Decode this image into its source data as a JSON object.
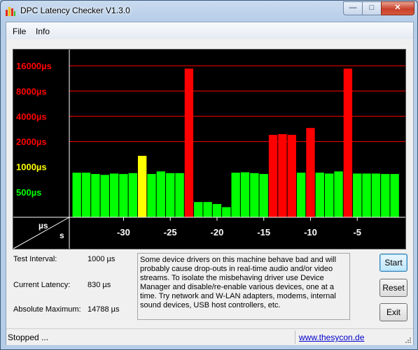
{
  "window": {
    "title": "DPC Latency Checker V1.3.0",
    "buttons": {
      "minimize": "—",
      "maximize": "□",
      "close": "✕"
    }
  },
  "menu": {
    "file": "File",
    "info": "Info"
  },
  "chart_data": {
    "type": "bar",
    "title": "",
    "xlabel": "s",
    "ylabel": "µs",
    "y_scale": "log2",
    "ylim": [
      250,
      24000
    ],
    "xlim": [
      -35.8,
      0
    ],
    "x_ticks": [
      -30,
      -25,
      -20,
      -15,
      -10,
      -5
    ],
    "x_tick_labels": [
      "-30",
      "-25",
      "-20",
      "-15",
      "-10",
      "-5"
    ],
    "y_ticks": [
      {
        "value": 16000,
        "label": "16000µs",
        "color": "#ff0000"
      },
      {
        "value": 8000,
        "label": "8000µs",
        "color": "#ff0000"
      },
      {
        "value": 4000,
        "label": "4000µs",
        "color": "#ff0000"
      },
      {
        "value": 2000,
        "label": "2000µs",
        "color": "#ff0000"
      },
      {
        "value": 1000,
        "label": "1000µs",
        "color": "#ffff00"
      },
      {
        "value": 500,
        "label": "500µs",
        "color": "#00ff00"
      }
    ],
    "bar_x": [
      -35,
      -34,
      -33,
      -32,
      -31,
      -30,
      -29,
      -28,
      -27,
      -26,
      -25,
      -24,
      -23,
      -22,
      -21,
      -20,
      -19,
      -18,
      -17,
      -16,
      -15,
      -14,
      -13,
      -12,
      -11,
      -10,
      -9,
      -8,
      -7,
      -6,
      -5,
      -4,
      -3,
      -2,
      -1
    ],
    "values": [
      850,
      850,
      820,
      800,
      830,
      820,
      840,
      1350,
      820,
      880,
      840,
      840,
      14800,
      380,
      380,
      360,
      330,
      850,
      860,
      840,
      820,
      2400,
      2450,
      2400,
      850,
      2900,
      850,
      830,
      880,
      14800,
      830,
      830,
      830,
      820,
      820
    ],
    "levels": [
      "green",
      "green",
      "green",
      "green",
      "green",
      "green",
      "green",
      "yellow",
      "green",
      "green",
      "green",
      "green",
      "red",
      "green",
      "green",
      "green",
      "green",
      "green",
      "green",
      "green",
      "green",
      "red",
      "red",
      "red",
      "green",
      "red",
      "green",
      "green",
      "green",
      "red",
      "green",
      "green",
      "green",
      "green",
      "green"
    ],
    "level_colors": {
      "green": "#00ff00",
      "yellow": "#ffff00",
      "red": "#ff0000"
    },
    "gridlines": "horizontal",
    "grid_color": "#ff0000",
    "background": "#000000"
  },
  "stats": {
    "test_interval_label": "Test Interval:",
    "test_interval_value": "1000 µs",
    "current_latency_label": "Current Latency:",
    "current_latency_value": "830 µs",
    "absolute_maximum_label": "Absolute Maximum:",
    "absolute_maximum_value": "14788 µs"
  },
  "message": "Some device drivers on this machine behave bad and will probably cause drop-outs in real-time audio and/or video streams. To isolate the misbehaving driver use Device Manager and disable/re-enable various devices, one at a time. Try network and W-LAN adapters, modems, internal sound devices, USB host controllers, etc.",
  "buttons": {
    "start": "Start",
    "reset": "Reset",
    "exit": "Exit"
  },
  "status": {
    "text": "Stopped ...",
    "link": "www.thesycon.de"
  }
}
